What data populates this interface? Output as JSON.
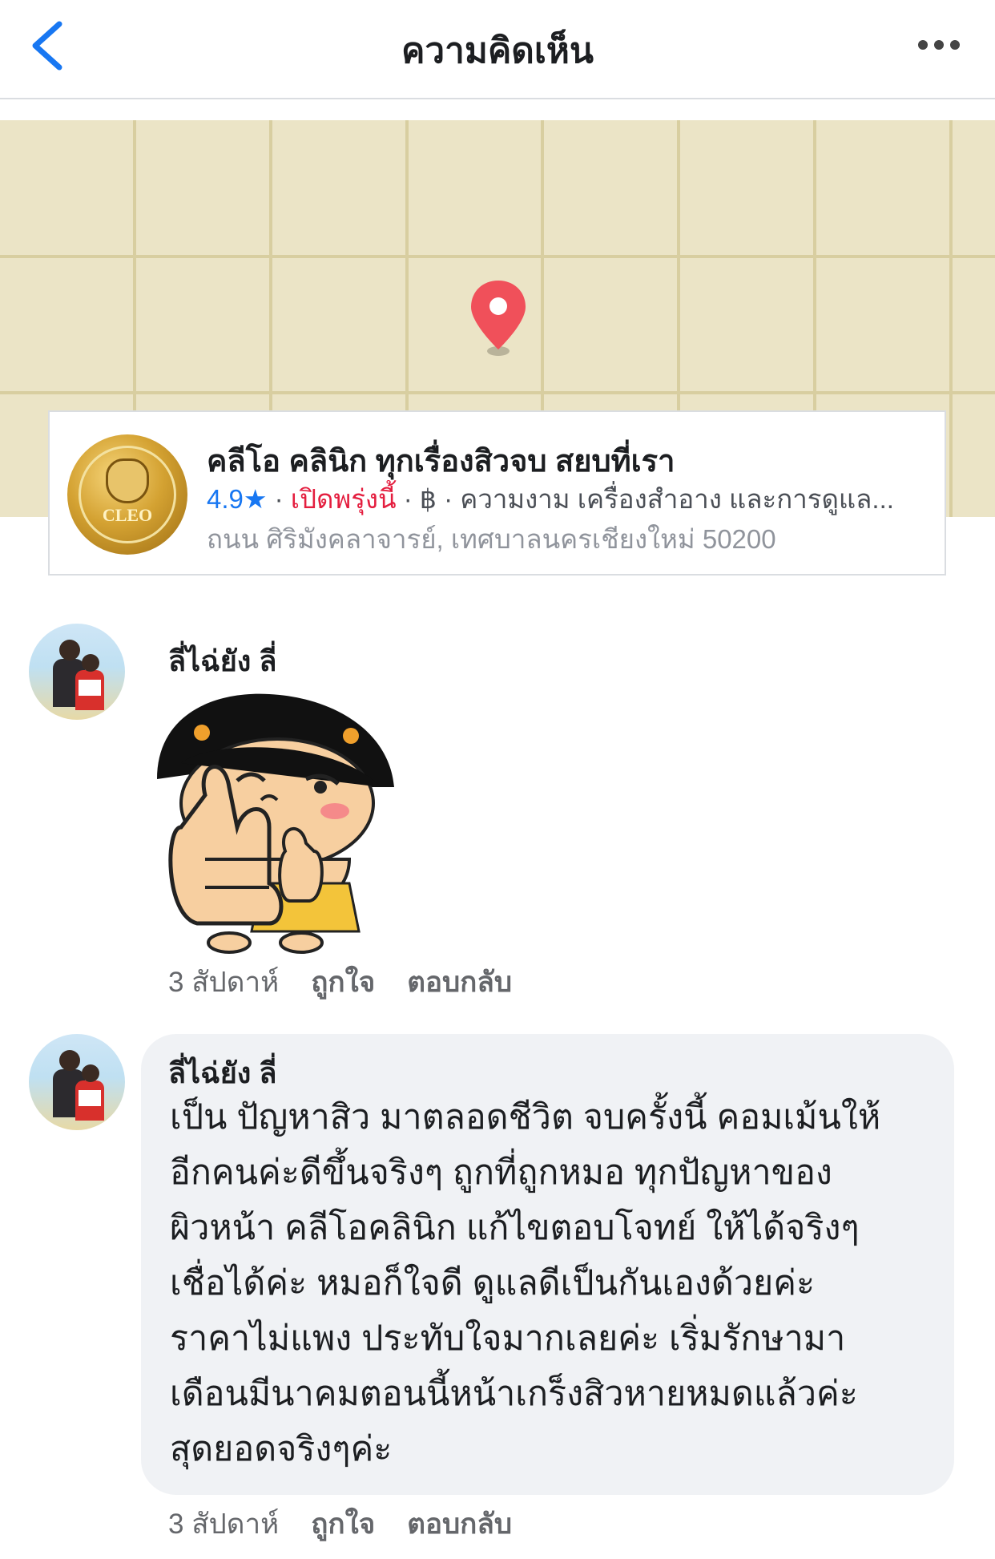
{
  "header": {
    "title": "ความคิดเห็น"
  },
  "place": {
    "name": "คลีโอ คลินิก ทุกเรื่องสิวจบ สยบที่เรา",
    "rating": "4.9★",
    "sep1": " · ",
    "hours": "เปิดพรุ่งนี้",
    "sep2": " · ฿ · ",
    "category": "ความงาม เครื่องสำอาง และการดูแล...",
    "address": "ถนน ศิริมังคลาจารย์, เทศบาลนครเชียงใหม่ 50200",
    "logo_text": "CLEO"
  },
  "comments": [
    {
      "author": "ลี่ไฉ่ยัง ลี่",
      "time": "3 สัปดาห์",
      "like": "ถูกใจ",
      "reply": "ตอบกลับ"
    },
    {
      "author": "ลี่ไฉ่ยัง ลี่",
      "lines": [
        "เป็น ปัญหาสิว มาตลอดชีวิต จบครั้งนี้ คอมเม้นให้",
        "อีกคนค่ะดีขึ้นจริงๆ  ถูกที่ถูกหมอ ทุกปัญหาของ",
        "ผิวหน้า คลีโอคลินิก แก้ไขตอบโจทย์ ให้ได้จริงๆ",
        "เชื่อได้ค่ะ หมอก็ใจดี ดูแลดีเป็นกันเองด้วยค่ะ",
        "ราคาไม่แพง ประทับใจมากเลยค่ะ เริ่มรักษามา",
        "เดือนมีนาคมตอนนี้หน้าเกร็งสิวหายหมดแล้วค่ะ",
        "สุดยอดจริงๆค่ะ"
      ],
      "time": "3 สัปดาห์",
      "like": "ถูกใจ",
      "reply": "ตอบกลับ"
    }
  ],
  "colors": {
    "accent": "#1877f2",
    "open": "#e41e3f",
    "map_bg": "#ebe4c6",
    "pin": "#f0505a"
  },
  "icons": [
    "back-chevron-icon",
    "more-dots-icon",
    "map-pin-icon"
  ]
}
